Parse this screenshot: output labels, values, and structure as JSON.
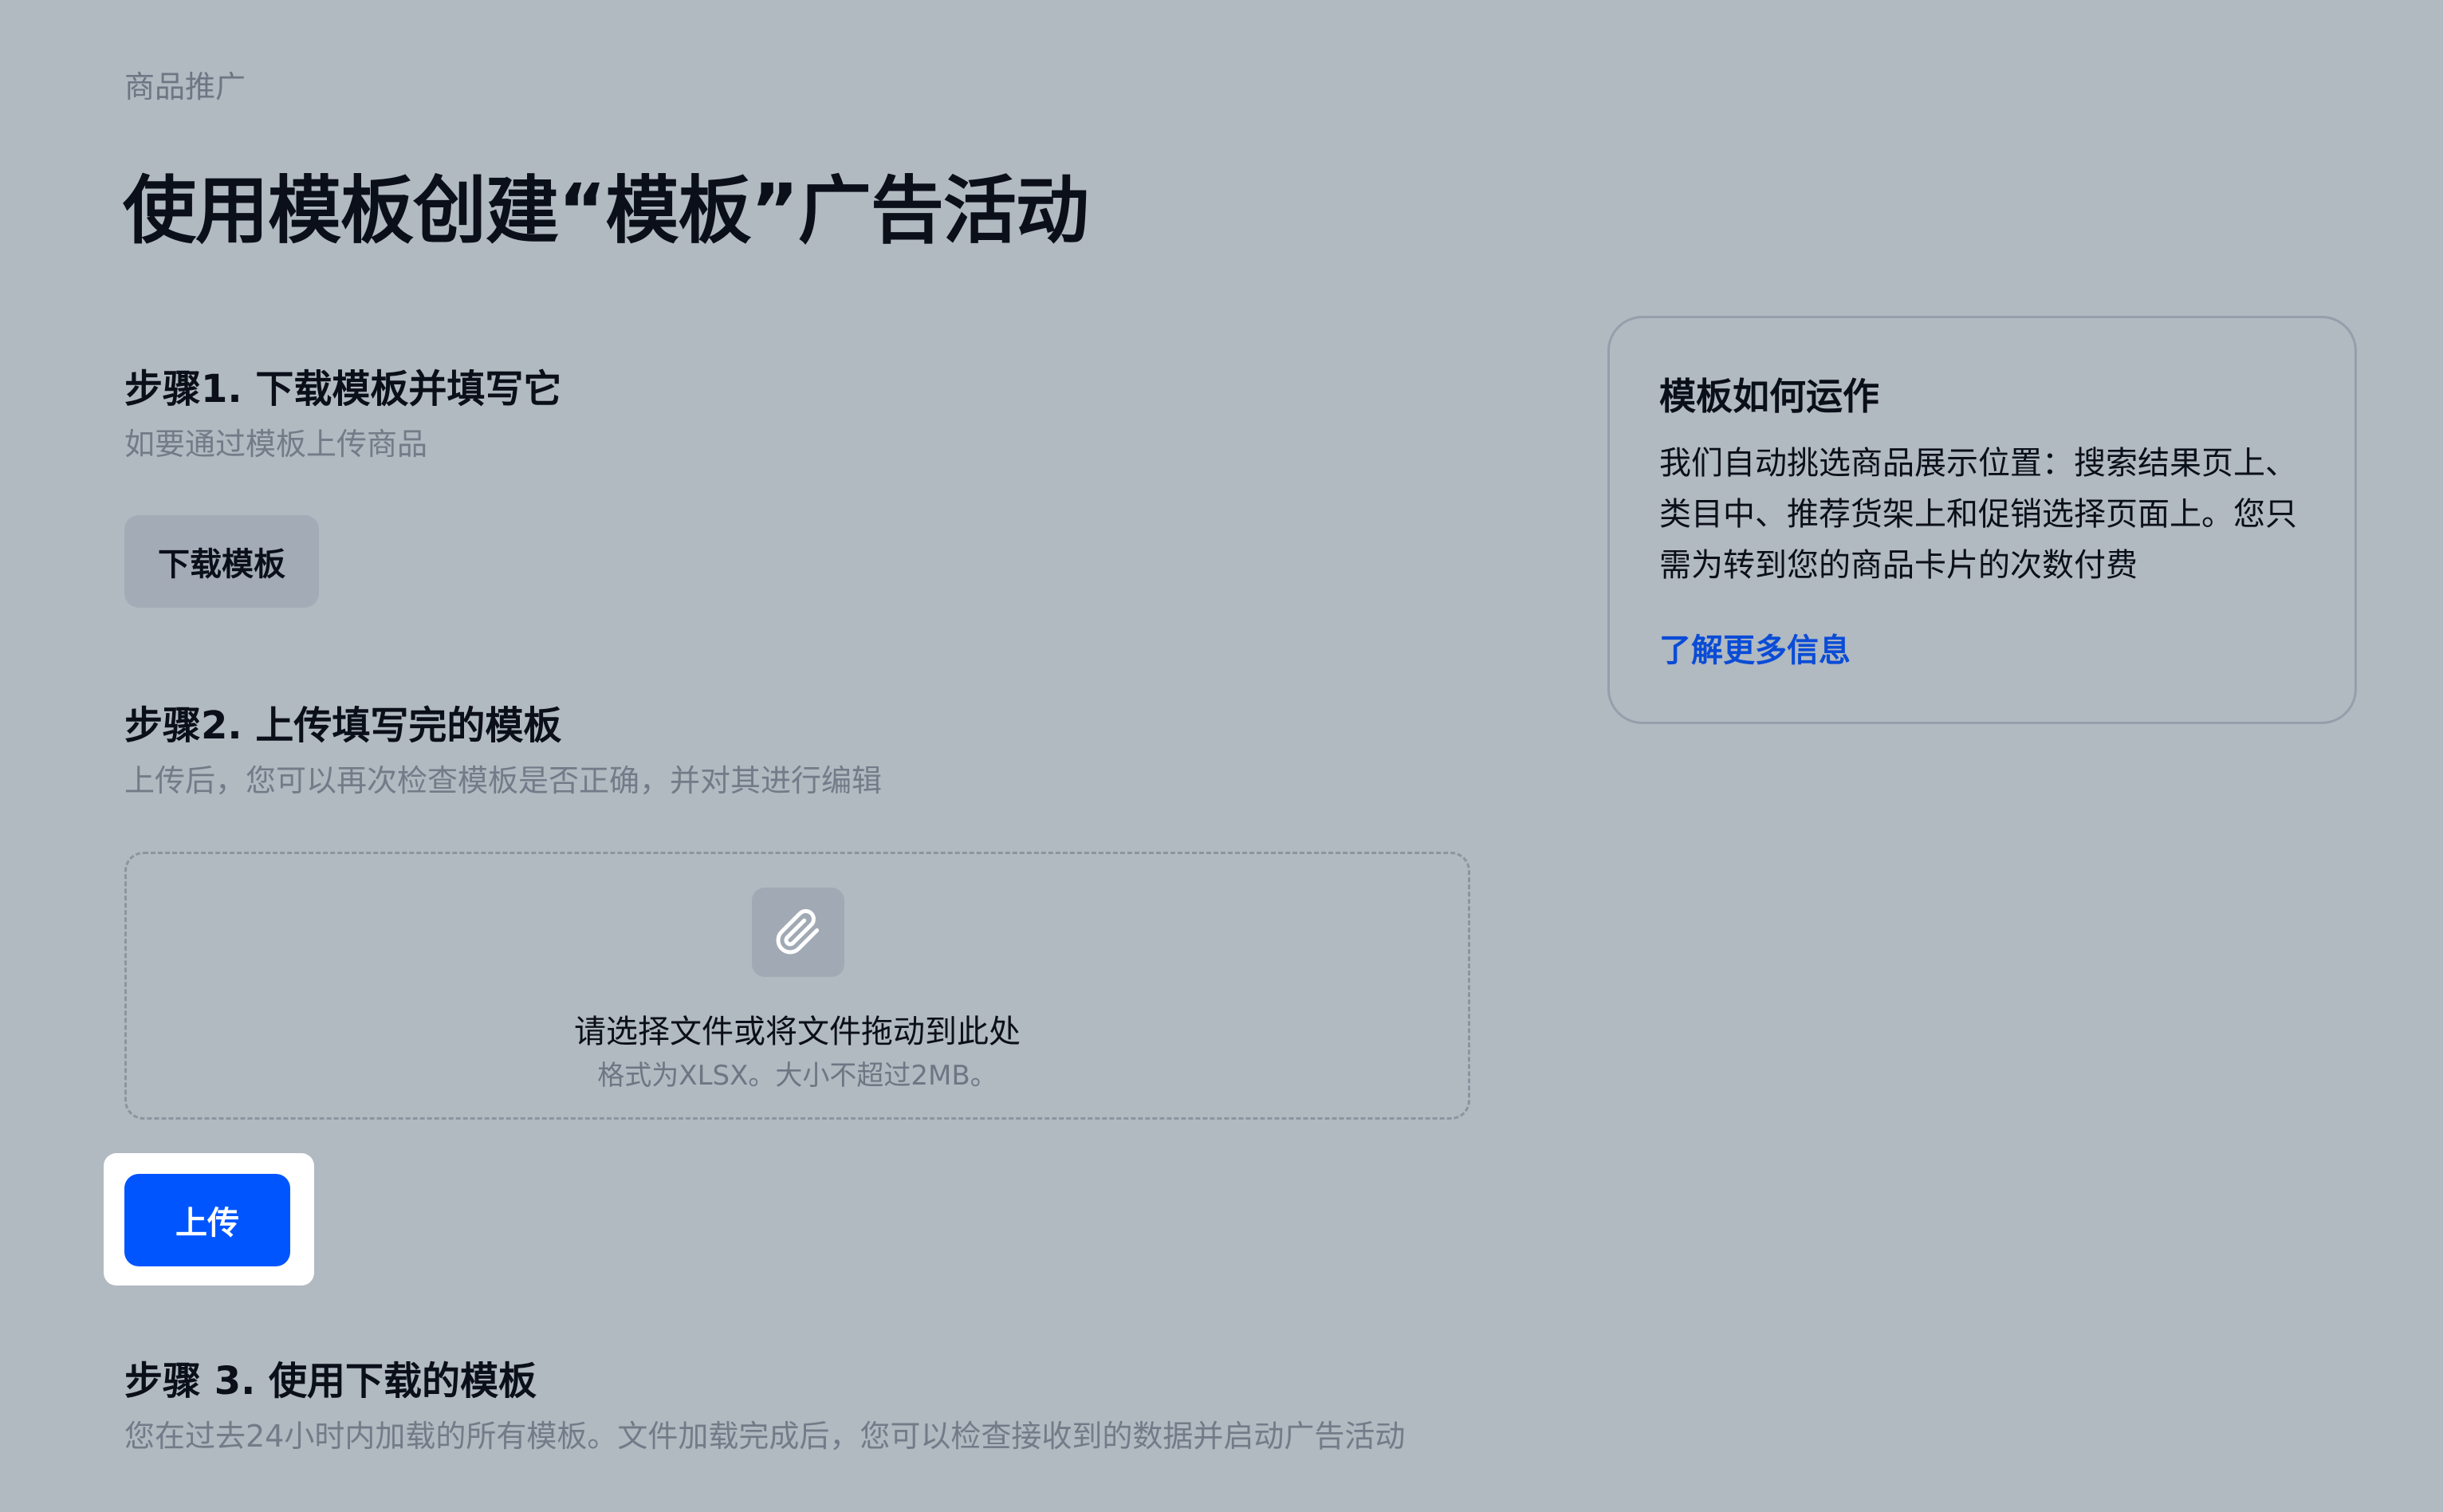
{
  "breadcrumb": "商品推广",
  "page_title": "使用模板创建“模板”广告活动",
  "step1": {
    "title": "步骤1. 下载模板并填写它",
    "subtitle": "如要通过模板上传商品",
    "download_button": "下载模板"
  },
  "step2": {
    "title": "步骤2. 上传填写完的模板",
    "subtitle": "上传后，您可以再次检查模板是否正确，并对其进行编辑",
    "dropzone": {
      "icon": "paperclip-icon",
      "text": "请选择文件或将文件拖动到此处",
      "hint": "格式为XLSX。大小不超过2MB。"
    },
    "upload_button": "上传"
  },
  "step3": {
    "title": "步骤 3. 使用下载的模板",
    "subtitle": "您在过去24小时内加载的所有模板。文件加载完成后，您可以检查接收到的数据并启动广告活动"
  },
  "info_card": {
    "title": "模板如何运作",
    "body": "我们自动挑选商品展示位置：搜索结果页上、类目中、推荐货架上和促销选择页面上。您只需为转到您的商品卡片的次数付费",
    "link": "了解更多信息"
  },
  "colors": {
    "background": "#b1b9c1",
    "primary": "#0055ff",
    "link": "#0a4cd6"
  }
}
